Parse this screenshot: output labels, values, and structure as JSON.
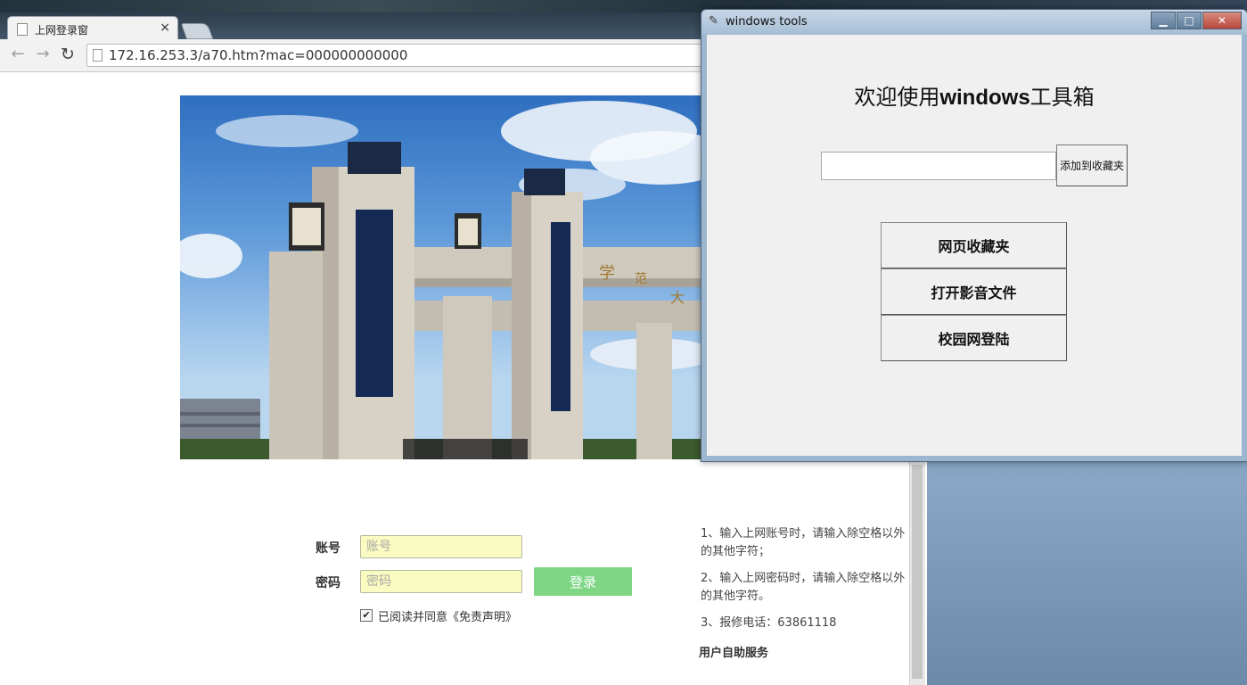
{
  "browser": {
    "tab_title": "上网登录窗",
    "tab_close": "×",
    "url": "172.16.253.3/a70.htm?mac=000000000000",
    "nav": {
      "back": "←",
      "forward": "→",
      "reload": "↻"
    }
  },
  "login": {
    "account_label": "账号",
    "account_placeholder": "账号",
    "password_label": "密码",
    "password_placeholder": "密码",
    "login_button": "登录",
    "agree_checked": true,
    "agree_text": "已阅读并同意《免责声明》"
  },
  "tips": [
    "1、输入上网账号时，请输入除空格以外的其他字符；",
    "2、输入上网密码时，请输入除空格以外的其他字符。",
    "3、报修电话：63861118"
  ],
  "self_service": "用户自助服务",
  "tk_window": {
    "title": "windows tools",
    "heading_prefix": "欢迎使用",
    "heading_brand": "windows",
    "heading_suffix": "工具箱",
    "entry_value": "",
    "add_button": "添加到收藏夹",
    "buttons": [
      "网页收藏夹",
      "打开影音文件",
      "校园网登陆"
    ],
    "controls": {
      "minimize": "▁",
      "maximize": "□",
      "close": "✕"
    }
  },
  "colors": {
    "login_button": "#7ed685",
    "input_bg": "#fafbc0",
    "tk_bg": "#f0f0f0"
  }
}
